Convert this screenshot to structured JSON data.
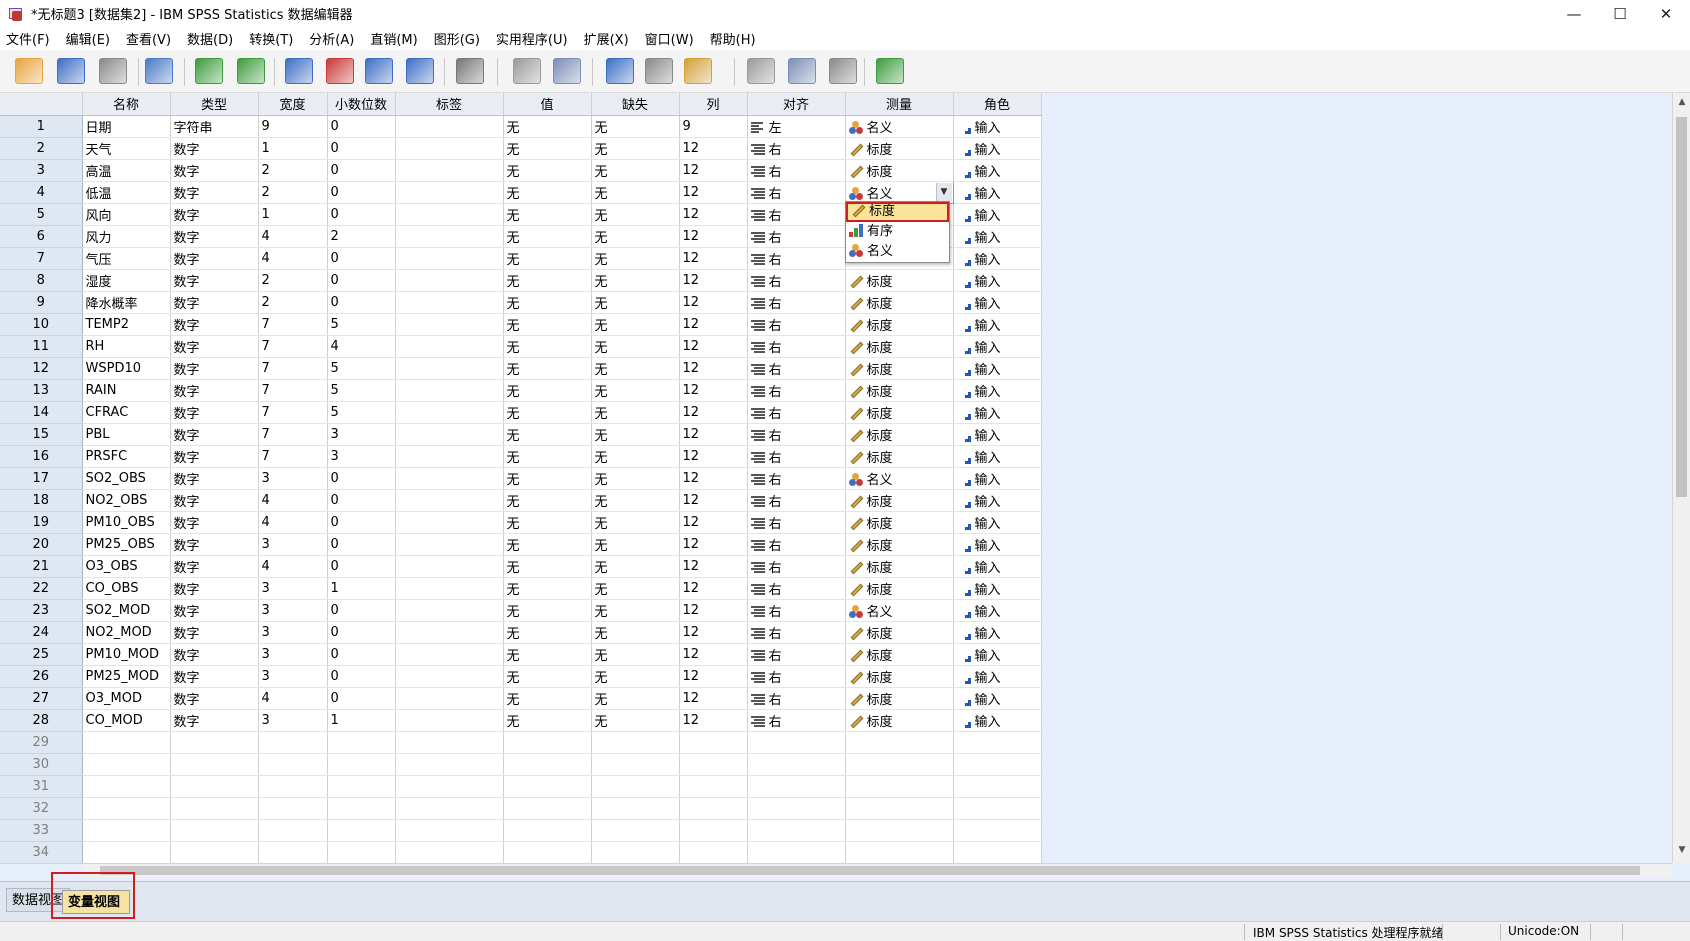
{
  "window": {
    "title": "*无标题3 [数据集2] - IBM SPSS Statistics 数据编辑器",
    "minimize": "—",
    "maximize": "☐",
    "close": "✕"
  },
  "menu": [
    "文件(F)",
    "编辑(E)",
    "查看(V)",
    "数据(D)",
    "转换(T)",
    "分析(A)",
    "直销(M)",
    "图形(G)",
    "实用程序(U)",
    "扩展(X)",
    "窗口(W)",
    "帮助(H)"
  ],
  "toolbar": {
    "icons": [
      "open-folder",
      "save",
      "print",
      "dialog-recall",
      "undo",
      "redo",
      "goto-case",
      "goto-variable",
      "variables",
      "run-descriptives",
      "find",
      "insert-cases",
      "insert-variable",
      "split-file",
      "weight-cases",
      "select-cases",
      "value-labels",
      "use-sets",
      "show-all-variables",
      "spell-check"
    ],
    "colors": {
      "open-folder": "#e8a33d",
      "save": "#3e6fc4",
      "print": "#8a8a8a",
      "dialog-recall": "#4a7bc8",
      "undo": "#3e9c3e",
      "redo": "#3e9c3e",
      "goto-case": "#3e6fc4",
      "goto-variable": "#c83a3a",
      "variables": "#3e6fc4",
      "run-descriptives": "#3e6fc4",
      "find": "#777777",
      "insert-cases": "#9a9a9a",
      "insert-variable": "#7b8fb5",
      "split-file": "#3e6fc4",
      "weight-cases": "#8a8a8a",
      "select-cases": "#d2a23a",
      "value-labels": "#9a9a9a",
      "use-sets": "#7b8fb5",
      "show-all-variables": "#8a8a8a",
      "spell-check": "#3e9c3e"
    }
  },
  "columns": [
    "名称",
    "类型",
    "宽度",
    "小数位数",
    "标签",
    "值",
    "缺失",
    "列",
    "对齐",
    "测量",
    "角色"
  ],
  "rows": [
    {
      "n": "1",
      "name": "日期",
      "type": "字符串",
      "width": "9",
      "dec": "0",
      "label": "",
      "values": "无",
      "missing": "无",
      "cols": "9",
      "align": "左",
      "measure": "名义",
      "measure_type": "nominal",
      "role": "输入"
    },
    {
      "n": "2",
      "name": "天气",
      "type": "数字",
      "width": "1",
      "dec": "0",
      "label": "",
      "values": "无",
      "missing": "无",
      "cols": "12",
      "align": "右",
      "measure": "标度",
      "measure_type": "scale",
      "role": "输入"
    },
    {
      "n": "3",
      "name": "高温",
      "type": "数字",
      "width": "2",
      "dec": "0",
      "label": "",
      "values": "无",
      "missing": "无",
      "cols": "12",
      "align": "右",
      "measure": "标度",
      "measure_type": "scale",
      "role": "输入"
    },
    {
      "n": "4",
      "name": "低温",
      "type": "数字",
      "width": "2",
      "dec": "0",
      "label": "",
      "values": "无",
      "missing": "无",
      "cols": "12",
      "align": "右",
      "measure": "名义",
      "measure_type": "nominal",
      "role": "输入",
      "editing": true
    },
    {
      "n": "5",
      "name": "风向",
      "type": "数字",
      "width": "1",
      "dec": "0",
      "label": "",
      "values": "无",
      "missing": "无",
      "cols": "12",
      "align": "右",
      "measure": "",
      "measure_type": "",
      "role": "输入"
    },
    {
      "n": "6",
      "name": "风力",
      "type": "数字",
      "width": "4",
      "dec": "2",
      "label": "",
      "values": "无",
      "missing": "无",
      "cols": "12",
      "align": "右",
      "measure": "",
      "measure_type": "",
      "role": "输入"
    },
    {
      "n": "7",
      "name": "气压",
      "type": "数字",
      "width": "4",
      "dec": "0",
      "label": "",
      "values": "无",
      "missing": "无",
      "cols": "12",
      "align": "右",
      "measure": "",
      "measure_type": "",
      "role": "输入"
    },
    {
      "n": "8",
      "name": "湿度",
      "type": "数字",
      "width": "2",
      "dec": "0",
      "label": "",
      "values": "无",
      "missing": "无",
      "cols": "12",
      "align": "右",
      "measure": "标度",
      "measure_type": "scale",
      "role": "输入"
    },
    {
      "n": "9",
      "name": "降水概率",
      "type": "数字",
      "width": "2",
      "dec": "0",
      "label": "",
      "values": "无",
      "missing": "无",
      "cols": "12",
      "align": "右",
      "measure": "标度",
      "measure_type": "scale",
      "role": "输入"
    },
    {
      "n": "10",
      "name": "TEMP2",
      "type": "数字",
      "width": "7",
      "dec": "5",
      "label": "",
      "values": "无",
      "missing": "无",
      "cols": "12",
      "align": "右",
      "measure": "标度",
      "measure_type": "scale",
      "role": "输入"
    },
    {
      "n": "11",
      "name": "RH",
      "type": "数字",
      "width": "7",
      "dec": "4",
      "label": "",
      "values": "无",
      "missing": "无",
      "cols": "12",
      "align": "右",
      "measure": "标度",
      "measure_type": "scale",
      "role": "输入"
    },
    {
      "n": "12",
      "name": "WSPD10",
      "type": "数字",
      "width": "7",
      "dec": "5",
      "label": "",
      "values": "无",
      "missing": "无",
      "cols": "12",
      "align": "右",
      "measure": "标度",
      "measure_type": "scale",
      "role": "输入"
    },
    {
      "n": "13",
      "name": "RAIN",
      "type": "数字",
      "width": "7",
      "dec": "5",
      "label": "",
      "values": "无",
      "missing": "无",
      "cols": "12",
      "align": "右",
      "measure": "标度",
      "measure_type": "scale",
      "role": "输入"
    },
    {
      "n": "14",
      "name": "CFRAC",
      "type": "数字",
      "width": "7",
      "dec": "5",
      "label": "",
      "values": "无",
      "missing": "无",
      "cols": "12",
      "align": "右",
      "measure": "标度",
      "measure_type": "scale",
      "role": "输入"
    },
    {
      "n": "15",
      "name": "PBL",
      "type": "数字",
      "width": "7",
      "dec": "3",
      "label": "",
      "values": "无",
      "missing": "无",
      "cols": "12",
      "align": "右",
      "measure": "标度",
      "measure_type": "scale",
      "role": "输入"
    },
    {
      "n": "16",
      "name": "PRSFC",
      "type": "数字",
      "width": "7",
      "dec": "3",
      "label": "",
      "values": "无",
      "missing": "无",
      "cols": "12",
      "align": "右",
      "measure": "标度",
      "measure_type": "scale",
      "role": "输入"
    },
    {
      "n": "17",
      "name": "SO2_OBS",
      "type": "数字",
      "width": "3",
      "dec": "0",
      "label": "",
      "values": "无",
      "missing": "无",
      "cols": "12",
      "align": "右",
      "measure": "名义",
      "measure_type": "nominal",
      "role": "输入"
    },
    {
      "n": "18",
      "name": "NO2_OBS",
      "type": "数字",
      "width": "4",
      "dec": "0",
      "label": "",
      "values": "无",
      "missing": "无",
      "cols": "12",
      "align": "右",
      "measure": "标度",
      "measure_type": "scale",
      "role": "输入"
    },
    {
      "n": "19",
      "name": "PM10_OBS",
      "type": "数字",
      "width": "4",
      "dec": "0",
      "label": "",
      "values": "无",
      "missing": "无",
      "cols": "12",
      "align": "右",
      "measure": "标度",
      "measure_type": "scale",
      "role": "输入"
    },
    {
      "n": "20",
      "name": "PM25_OBS",
      "type": "数字",
      "width": "3",
      "dec": "0",
      "label": "",
      "values": "无",
      "missing": "无",
      "cols": "12",
      "align": "右",
      "measure": "标度",
      "measure_type": "scale",
      "role": "输入"
    },
    {
      "n": "21",
      "name": "O3_OBS",
      "type": "数字",
      "width": "4",
      "dec": "0",
      "label": "",
      "values": "无",
      "missing": "无",
      "cols": "12",
      "align": "右",
      "measure": "标度",
      "measure_type": "scale",
      "role": "输入"
    },
    {
      "n": "22",
      "name": "CO_OBS",
      "type": "数字",
      "width": "3",
      "dec": "1",
      "label": "",
      "values": "无",
      "missing": "无",
      "cols": "12",
      "align": "右",
      "measure": "标度",
      "measure_type": "scale",
      "role": "输入"
    },
    {
      "n": "23",
      "name": "SO2_MOD",
      "type": "数字",
      "width": "3",
      "dec": "0",
      "label": "",
      "values": "无",
      "missing": "无",
      "cols": "12",
      "align": "右",
      "measure": "名义",
      "measure_type": "nominal",
      "role": "输入"
    },
    {
      "n": "24",
      "name": "NO2_MOD",
      "type": "数字",
      "width": "3",
      "dec": "0",
      "label": "",
      "values": "无",
      "missing": "无",
      "cols": "12",
      "align": "右",
      "measure": "标度",
      "measure_type": "scale",
      "role": "输入"
    },
    {
      "n": "25",
      "name": "PM10_MOD",
      "type": "数字",
      "width": "3",
      "dec": "0",
      "label": "",
      "values": "无",
      "missing": "无",
      "cols": "12",
      "align": "右",
      "measure": "标度",
      "measure_type": "scale",
      "role": "输入"
    },
    {
      "n": "26",
      "name": "PM25_MOD",
      "type": "数字",
      "width": "3",
      "dec": "0",
      "label": "",
      "values": "无",
      "missing": "无",
      "cols": "12",
      "align": "右",
      "measure": "标度",
      "measure_type": "scale",
      "role": "输入"
    },
    {
      "n": "27",
      "name": "O3_MOD",
      "type": "数字",
      "width": "4",
      "dec": "0",
      "label": "",
      "values": "无",
      "missing": "无",
      "cols": "12",
      "align": "右",
      "measure": "标度",
      "measure_type": "scale",
      "role": "输入"
    },
    {
      "n": "28",
      "name": "CO_MOD",
      "type": "数字",
      "width": "3",
      "dec": "1",
      "label": "",
      "values": "无",
      "missing": "无",
      "cols": "12",
      "align": "右",
      "measure": "标度",
      "measure_type": "scale",
      "role": "输入"
    }
  ],
  "empty_rows": [
    "29",
    "30",
    "31",
    "32",
    "33",
    "34"
  ],
  "measure_dropdown": {
    "options": [
      {
        "label": "标度",
        "icon": "scale-ruler-icon",
        "selected": true
      },
      {
        "label": "有序",
        "icon": "ordinal-bars-icon",
        "selected": false
      },
      {
        "label": "名义",
        "icon": "nominal-circles-icon",
        "selected": false
      }
    ]
  },
  "view_tabs": {
    "data": "数据视图",
    "variable": "变量视图",
    "active": "变量视图"
  },
  "status": {
    "processor": "IBM SPSS Statistics 处理程序就绪",
    "unicode": "Unicode:ON"
  },
  "colors": {
    "header_bg": "#e9edf3",
    "rownum_bg": "#dfe7f2",
    "grid_bg": "#e6effb",
    "active_tab": "#f6e2a3",
    "highlight": "#d01e1e",
    "selected_option": "#fbe49a"
  }
}
